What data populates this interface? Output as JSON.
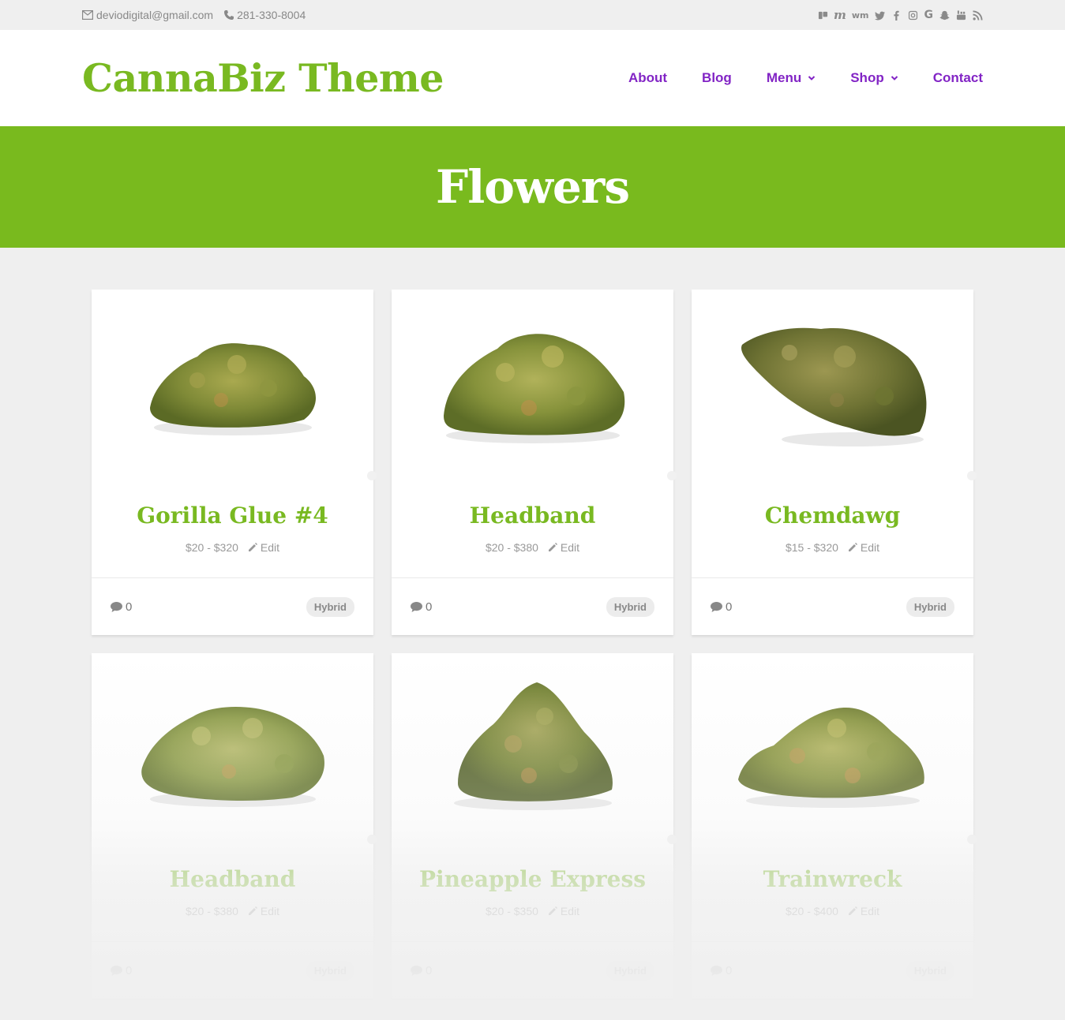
{
  "topbar": {
    "email": "deviodigital@gmail.com",
    "phone": "281-330-8004",
    "social_icons": [
      "leafly-icon",
      "weedmaps-m-icon",
      "wm-icon",
      "twitter-icon",
      "facebook-icon",
      "instagram-icon",
      "google-icon",
      "snapchat-icon",
      "youtube-icon",
      "rss-icon"
    ]
  },
  "header": {
    "logo": "CannaBiz Theme",
    "nav": [
      {
        "label": "About"
      },
      {
        "label": "Blog"
      },
      {
        "label": "Menu"
      },
      {
        "label": "Shop"
      },
      {
        "label": "Contact"
      }
    ]
  },
  "hero": {
    "title": "Flowers"
  },
  "colors": {
    "brand_green": "#79b921",
    "nav_purple": "#8224c5",
    "background": "#efefef"
  },
  "products": [
    {
      "name": "Gorilla Glue #4",
      "price": "$20 - $320",
      "edit": "Edit",
      "comments": "0",
      "category": "Hybrid"
    },
    {
      "name": "Headband",
      "price": "$20 - $380",
      "edit": "Edit",
      "comments": "0",
      "category": "Hybrid"
    },
    {
      "name": "Chemdawg",
      "price": "$15 - $320",
      "edit": "Edit",
      "comments": "0",
      "category": "Hybrid"
    },
    {
      "name": "Headband",
      "price": "$20 - $380",
      "edit": "Edit",
      "comments": "0",
      "category": "Hybrid"
    },
    {
      "name": "Pineapple Express",
      "price": "$20 - $350",
      "edit": "Edit",
      "comments": "0",
      "category": "Hybrid"
    },
    {
      "name": "Trainwreck",
      "price": "$20 - $400",
      "edit": "Edit",
      "comments": "0",
      "category": "Hybrid"
    }
  ]
}
